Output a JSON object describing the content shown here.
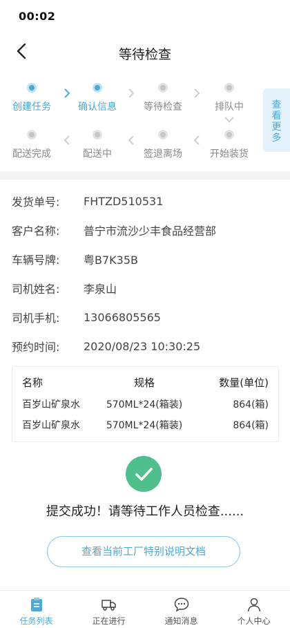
{
  "status": {
    "time": "00:02"
  },
  "header": {
    "title": "等待检查"
  },
  "progress": {
    "steps": [
      {
        "label": "创建任务",
        "state": "done"
      },
      {
        "label": "确认信息",
        "state": "done"
      },
      {
        "label": "等待检查",
        "state": "todo"
      },
      {
        "label": "排队中",
        "state": "todo"
      },
      {
        "label": "开始装货",
        "state": "todo"
      },
      {
        "label": "签退离场",
        "state": "todo"
      },
      {
        "label": "配送中",
        "state": "todo"
      },
      {
        "label": "配送完成",
        "state": "todo"
      }
    ],
    "more_label": "查看更多"
  },
  "info": [
    {
      "key": "发货单号:",
      "value": "FHTZD510531"
    },
    {
      "key": "客户名称:",
      "value": "普宁市流沙少丰食品经营部"
    },
    {
      "key": "车辆号牌:",
      "value": "粤B7K35B"
    },
    {
      "key": "司机姓名:",
      "value": "李泉山"
    },
    {
      "key": "司机手机:",
      "value": "13066805565"
    },
    {
      "key": "预约时间:",
      "value": "2020/08/23 10:30:25"
    }
  ],
  "goods": {
    "headers": [
      "名称",
      "规格",
      "数量(单位)"
    ],
    "rows": [
      [
        "百岁山矿泉水",
        "570ML*24(箱装)",
        "864(箱)"
      ],
      [
        "百岁山矿泉水",
        "570ML*24(箱装)",
        "864(箱)"
      ]
    ]
  },
  "result": {
    "message": "提交成功！请等待工作人员检查......"
  },
  "doc_button": {
    "label": "查看当前工厂特别说明文档"
  },
  "tabbar": {
    "items": [
      {
        "label": "任务列表",
        "icon": "clipboard-icon",
        "active": true
      },
      {
        "label": "正在进行",
        "icon": "truck-icon",
        "active": false
      },
      {
        "label": "通知消息",
        "icon": "chat-bubble-icon",
        "active": false
      },
      {
        "label": "个人中心",
        "icon": "person-icon",
        "active": false
      }
    ]
  },
  "colors": {
    "accent": "#4ea9d7",
    "success": "#4fc08d",
    "inactive": "#c6c6c6"
  }
}
